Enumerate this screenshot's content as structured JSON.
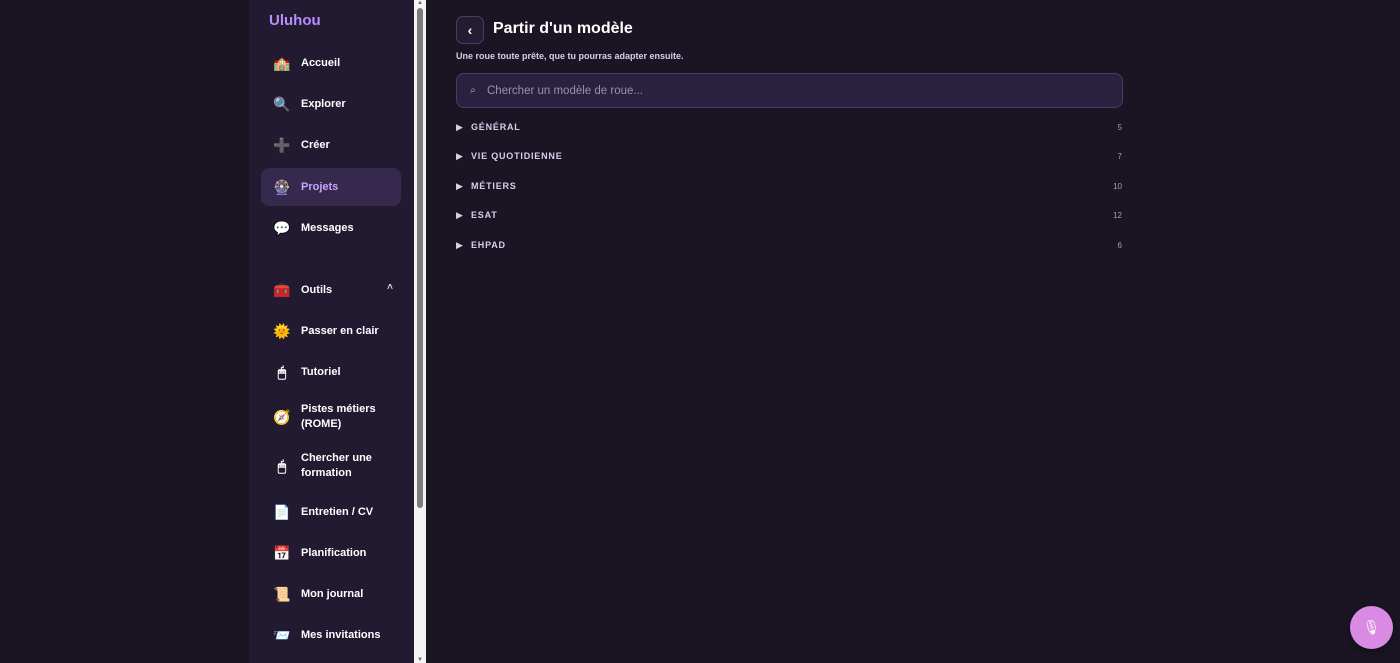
{
  "app": {
    "brand": "Uluhou"
  },
  "sidebar": {
    "items": [
      {
        "label": "Accueil",
        "icon": "🏫"
      },
      {
        "label": "Explorer",
        "icon": "🔍"
      },
      {
        "label": "Créer",
        "icon": "➕"
      },
      {
        "label": "Projets",
        "icon": "🎡"
      },
      {
        "label": "Messages",
        "icon": "💬"
      }
    ],
    "tools": {
      "label": "Outils",
      "icon": "🧰",
      "chevron": "˄",
      "items": [
        {
          "label": "Passer en clair",
          "icon": "🌞"
        },
        {
          "label": "Tutoriel",
          "icon": "🖱"
        },
        {
          "label": "Pistes métiers (ROME)",
          "icon": "🧭"
        },
        {
          "label": "Chercher une formation",
          "icon": "🖱"
        },
        {
          "label": "Entretien / CV",
          "icon": "📄"
        },
        {
          "label": "Planification",
          "icon": "📅"
        },
        {
          "label": "Mon journal",
          "icon": "📜"
        },
        {
          "label": "Mes invitations",
          "icon": "📨"
        }
      ]
    }
  },
  "main": {
    "back_icon": "‹",
    "title": "Partir d'un modèle",
    "subtitle": "Une roue toute prête, que tu pourras adapter ensuite.",
    "search": {
      "icon": "⌕",
      "placeholder": "Chercher un modèle de roue..."
    },
    "categories": [
      {
        "label": "GÉNÉRAL",
        "count": "5"
      },
      {
        "label": "VIE QUOTIDIENNE",
        "count": "7"
      },
      {
        "label": "MÉTIERS",
        "count": "10"
      },
      {
        "label": "ESAT",
        "count": "12"
      },
      {
        "label": "EHPAD",
        "count": "6"
      }
    ],
    "expand_icon": "▶"
  },
  "fab": {
    "icon": "🎙"
  },
  "colors": {
    "background": "#1a1423",
    "sidebar": "#221a31",
    "accent": "#b98cff",
    "fab": "#d98ae3"
  }
}
